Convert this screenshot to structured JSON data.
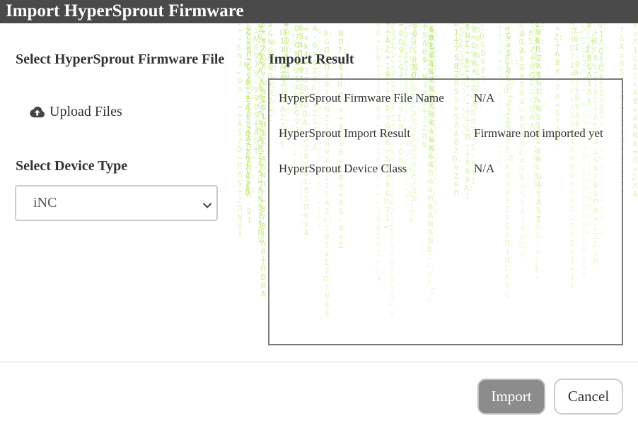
{
  "dialog": {
    "title": "Import HyperSprout Firmware"
  },
  "left": {
    "file_section_title": "Select HyperSprout Firmware File",
    "upload_label": "Upload Files",
    "upload_icon": "cloud-upload-icon",
    "device_type_label": "Select Device Type",
    "device_type_selected": "iNC",
    "device_type_chevron_icon": "chevron-down-icon"
  },
  "result": {
    "title": "Import Result",
    "rows": [
      {
        "label": "HyperSprout Firmware File Name",
        "value": "N/A"
      },
      {
        "label": "HyperSprout Import Result",
        "value": "Firmware not imported yet"
      },
      {
        "label": "HyperSprout Device Class",
        "value": "N/A"
      }
    ]
  },
  "footer": {
    "import_label": "Import",
    "cancel_label": "Cancel"
  },
  "colors": {
    "titlebar": "#4a4a4a",
    "matrix_green": "#b9e46a",
    "import_button": "#8c8c8c"
  }
}
